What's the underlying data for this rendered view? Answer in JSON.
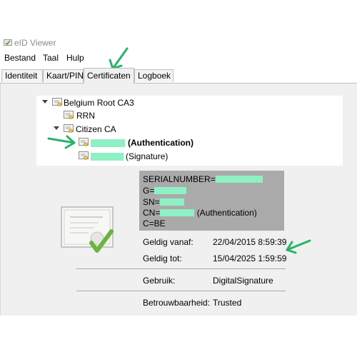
{
  "window": {
    "title": "eID Viewer"
  },
  "menu": {
    "items": [
      "Bestand",
      "Taal",
      "Hulp"
    ]
  },
  "tabs": [
    {
      "label": "Identiteit",
      "active": false
    },
    {
      "label": "Kaart/PIN",
      "active": false
    },
    {
      "label": "Certificaten",
      "active": true
    },
    {
      "label": "Logboek",
      "active": false
    }
  ],
  "tree": {
    "root": "Belgium Root CA3",
    "rrn": "RRN",
    "citizen_ca": "Citizen CA",
    "auth_cert": "(Authentication)",
    "sign_cert": "(Signature)"
  },
  "subject": {
    "serial_prefix": "SERIALNUMBER=",
    "g_prefix": "G=",
    "sn_prefix": "SN=",
    "cn_prefix": "CN=",
    "cn_suffix": "(Authentication)",
    "c": "C=BE"
  },
  "details": {
    "valid_from_label": "Geldig vanaf:",
    "valid_from": "22/04/2015 8:59:39",
    "valid_to_label": "Geldig tot:",
    "valid_to": "15/04/2025 1:59:59",
    "usage_label": "Gebruik:",
    "usage": "DigitalSignature",
    "trust_label": "Betrouwbaarheid:",
    "trust": "Trusted"
  },
  "colors": {
    "redaction": "#8ff0c4",
    "annotation_arrow": "#27b36a",
    "subject_box": "#aaaaaa",
    "panel": "#f0f0f0"
  }
}
